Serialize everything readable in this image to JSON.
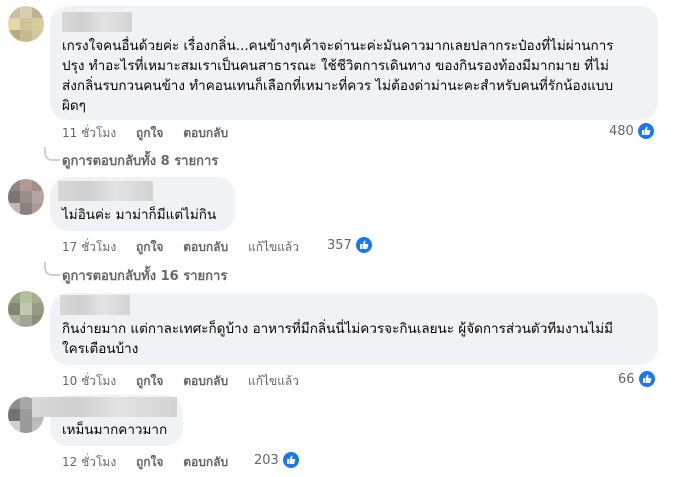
{
  "actions": {
    "like": "ถูกใจ",
    "reply": "ตอบกลับ",
    "edited": "แก้ไขแล้ว"
  },
  "comments": [
    {
      "text_lines": [
        "เกรงใจคนอื่นด้วยค่ะ เรื่องกลิ่น...คนข้างๆเค้าจะด่านะค่ะมันคาวมากเลยปลากระป๋องที่ไม่ผ่านการ",
        "ปรุง ทำอะไรที่เหมาะสมเราเป็นคนสาธารณะ ใช้ชีวิตการเดินทาง ของกินรองท้องมีมากมาย ที่ไม่",
        "ส่งกลิ่นรบกวนคนข้าง ทำคอนเทนก็เลือกที่เหมาะที่ควร ไม่ต้องด่าม่านะคะสำหรับคนที่รักน้องแบบ",
        "ผิดๆ"
      ],
      "time": "11 ชั่วโมง",
      "reactions": "480",
      "view_replies": "ดูการตอบกลับทั้ง 8 รายการ"
    },
    {
      "text_lines": [
        "ไม่อินค่ะ มาม่าก็มีแต่ไม่กิน"
      ],
      "time": "17 ชั่วโมง",
      "reactions": "357",
      "view_replies": "ดูการตอบกลับทั้ง 16 รายการ"
    },
    {
      "text_lines": [
        "กินง่ายมาก แต่กาละเทศะก็ดูบ้าง อาหารที่มีกลิ่นนี่ไม่ควรจะกินเลยนะ ผู้จัดการส่วนตัวทีมงานไม่มี",
        "ใครเตือนบ้าง"
      ],
      "time": "10 ชั่วโมง",
      "reactions": "66"
    },
    {
      "text_lines": [
        "เหม็นมากคาวมาก"
      ],
      "time": "12 ชั่วโมง",
      "reactions": "203"
    }
  ],
  "colors": {
    "bubble": "#f0f2f5",
    "meta": "#65676b",
    "like_blue": "#1877f2"
  },
  "icons": {
    "reaction": "thumbs-up-icon"
  }
}
